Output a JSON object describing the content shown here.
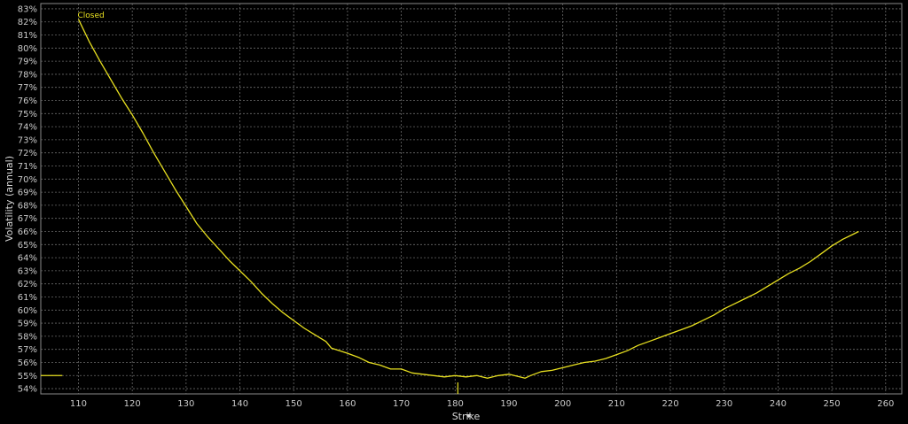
{
  "chart_data": {
    "type": "line",
    "xlabel": "Strike",
    "ylabel": "Volatility (annual)",
    "xlim": [
      103,
      263
    ],
    "ylim": [
      53.6,
      83.4
    ],
    "x_ticks": [
      110,
      120,
      130,
      140,
      150,
      160,
      170,
      180,
      190,
      200,
      210,
      220,
      230,
      240,
      250,
      260
    ],
    "y_ticks": [
      54,
      55,
      56,
      57,
      58,
      59,
      60,
      61,
      62,
      63,
      64,
      65,
      66,
      67,
      68,
      69,
      70,
      71,
      72,
      73,
      74,
      75,
      76,
      77,
      78,
      79,
      80,
      81,
      82,
      83
    ],
    "y_tick_suffix": "%",
    "grid": true,
    "line_color": "#e8e020",
    "series": [
      {
        "name": "Closed",
        "x": [
          110,
          112,
          114,
          116,
          118,
          120,
          122,
          124,
          126,
          128,
          130,
          132,
          134,
          136,
          138,
          140,
          142,
          144,
          146,
          148,
          150,
          152,
          154,
          156,
          157,
          160,
          162,
          164,
          166,
          168,
          170,
          172,
          174,
          176,
          178,
          180,
          182,
          184,
          186,
          188,
          190,
          192,
          193,
          194,
          196,
          198,
          200,
          202,
          204,
          206,
          208,
          210,
          212,
          214,
          216,
          218,
          220,
          222,
          224,
          226,
          228,
          230,
          232,
          234,
          236,
          238,
          240,
          242,
          244,
          246,
          248,
          250,
          252,
          254,
          255
        ],
        "y": [
          82.2,
          80.5,
          79.0,
          77.6,
          76.2,
          74.9,
          73.5,
          72.0,
          70.6,
          69.2,
          67.9,
          66.6,
          65.6,
          64.7,
          63.8,
          63.0,
          62.2,
          61.3,
          60.5,
          59.8,
          59.2,
          58.6,
          58.1,
          57.6,
          57.1,
          56.7,
          56.4,
          56.0,
          55.8,
          55.5,
          55.5,
          55.2,
          55.1,
          55.0,
          54.9,
          55.0,
          54.9,
          55.0,
          54.8,
          55.0,
          55.1,
          54.9,
          54.8,
          55.0,
          55.3,
          55.4,
          55.6,
          55.8,
          56.0,
          56.1,
          56.3,
          56.6,
          56.9,
          57.3,
          57.6,
          57.9,
          58.2,
          58.5,
          58.8,
          59.2,
          59.6,
          60.1,
          60.5,
          60.9,
          61.3,
          61.8,
          62.3,
          62.8,
          63.2,
          63.7,
          64.3,
          64.9,
          65.4,
          65.8,
          66.0
        ]
      }
    ],
    "left_marker": {
      "x": [
        103,
        107
      ],
      "y": 55.0
    },
    "current_price_marker": {
      "x": 180.5
    },
    "annotations": [
      {
        "text": "Closed",
        "x": 110,
        "y": 82.2
      }
    ]
  }
}
